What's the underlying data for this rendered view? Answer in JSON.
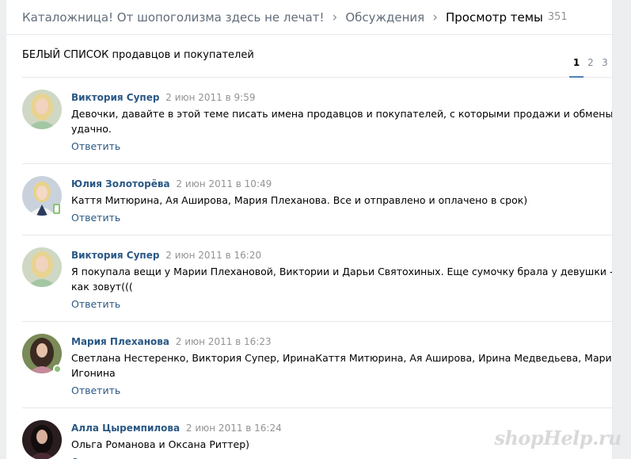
{
  "breadcrumb": {
    "group": "Каталожница! От шопоголизма здесь не лечат!",
    "discussions": "Обсуждения",
    "current": "Просмотр темы",
    "count": "351"
  },
  "topic": {
    "title": "БЕЛЫЙ СПИСОК продавцов и покупателей",
    "pages": [
      "1",
      "2",
      "3"
    ]
  },
  "reply_label": "Ответить",
  "posts": [
    {
      "author": "Виктория Супер",
      "date": "2 июн 2011 в 9:59",
      "lines": [
        "Девочки, давайте в этой теме писать имена продавцов и покупателей, с которыми продажи и обмены прошли",
        "удачно."
      ]
    },
    {
      "author": "Юлия Золоторёва",
      "date": "2 июн 2011 в 10:49",
      "lines": [
        "Каття Митюрина, Ая Аширова, Мария Плеханова. Все и отправлено и оплачено в срок)"
      ]
    },
    {
      "author": "Виктория Супер",
      "date": "2 июн 2011 в 16:20",
      "lines": [
        "Я покупала вещи у Марии Плехановой, Виктории и Дарьи Святохиных. Еще сумочку брала у девушки - не помню",
        "как зовут((("
      ]
    },
    {
      "author": "Мария Плеханова",
      "date": "2 июн 2011 в 16:23",
      "lines": [
        "Светлана Нестеренко, Виктория Супер, ИринаКаття Митюрина, Ая Аширова, Ирина Медведьева, Марина",
        "Игонина"
      ]
    },
    {
      "author": "Алла Цыремпилова",
      "date": "2 июн 2011 в 16:24",
      "lines": [
        "Ольга Романова и Оксана Риттер)"
      ]
    }
  ],
  "watermark": "shopHelp.ru"
}
